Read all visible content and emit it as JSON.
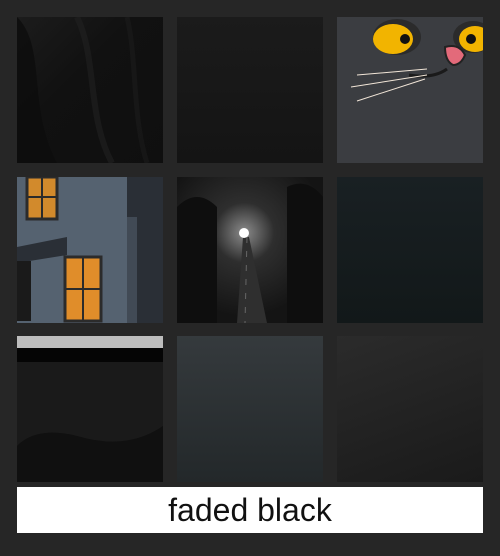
{
  "caption": "faded black",
  "tiles": [
    {
      "name": "tile-black-fabric"
    },
    {
      "name": "tile-dark-plain"
    },
    {
      "name": "tile-cat-face"
    },
    {
      "name": "tile-house-windows"
    },
    {
      "name": "tile-foggy-road"
    },
    {
      "name": "tile-dark-teal"
    },
    {
      "name": "tile-black-tabletop"
    },
    {
      "name": "tile-gray-wall"
    },
    {
      "name": "tile-textured-black"
    }
  ]
}
